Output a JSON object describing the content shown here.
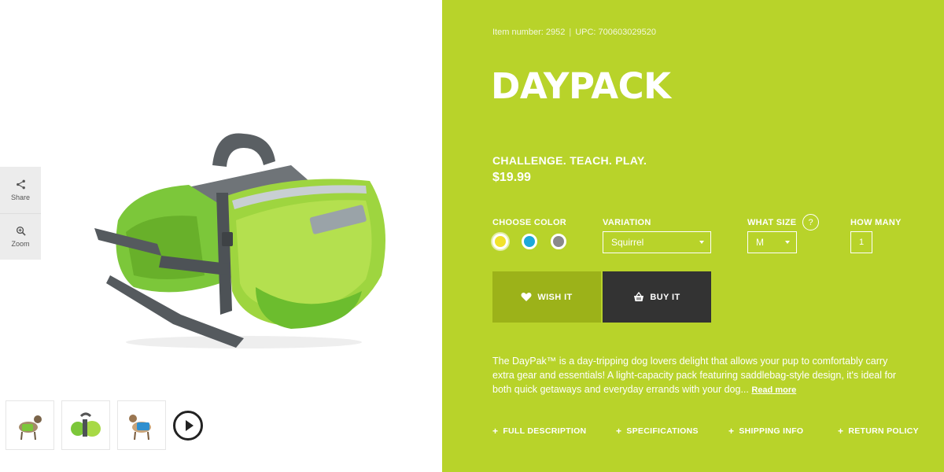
{
  "gallery": {
    "share_label": "Share",
    "zoom_label": "Zoom"
  },
  "product": {
    "item_number": "Item number: 2952",
    "upc": "UPC: 700603029520",
    "title": "DAYPACK",
    "tagline": "CHALLENGE. TEACH. PLAY.",
    "price": "$19.99"
  },
  "options": {
    "color_label": "CHOOSE COLOR",
    "colors": [
      "#f1e22b",
      "#1da9d9",
      "#8a8a8a"
    ],
    "variation_label": "VARIATION",
    "variation_value": "Squirrel",
    "size_label": "WHAT SIZE",
    "size_help": "?",
    "size_value": "M",
    "qty_label": "HOW MANY",
    "qty_value": "1"
  },
  "actions": {
    "wish_label": "WISH IT",
    "buy_label": "BUY IT"
  },
  "description": {
    "text": "The DayPak™ is a day-tripping dog lovers delight that allows your pup to comfortably carry extra gear and essentials! A light-capacity pack featuring saddlebag-style design, it's ideal for both quick getaways and everyday errands with your dog...",
    "read_more": "Read more"
  },
  "links": {
    "full_description": "FULL DESCRIPTION",
    "specifications": "SPECIFICATIONS",
    "shipping_info": "SHIPPING INFO",
    "return_policy": "RETURN POLICY"
  },
  "colors": {
    "panel": "#b8d32a",
    "wish_button": "#9cb219",
    "buy_button": "#333333"
  }
}
